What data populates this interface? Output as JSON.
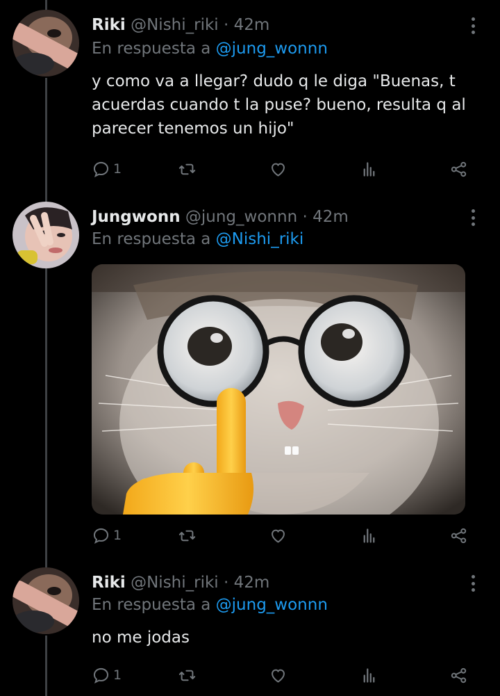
{
  "tweets": [
    {
      "name": "Riki",
      "handle": "@Nishi_riki",
      "dot": "·",
      "time": "42m",
      "reply_prefix": "En respuesta a",
      "reply_to": "@jung_wonnn",
      "text": "y como va a llegar? dudo q le diga \"Buenas, t acuerdas cuando t la puse? bueno, resulta q al parecer tenemos un hijo\"",
      "reply_count": "1"
    },
    {
      "name": "Jungwonn",
      "handle": "@jung_wonnn",
      "dot": "·",
      "time": "42m",
      "reply_prefix": "En respuesta a",
      "reply_to": "@Nishi_riki",
      "reply_count": "1",
      "media_description": "cat-with-glasses-meme"
    },
    {
      "name": "Riki",
      "handle": "@Nishi_riki",
      "dot": "·",
      "time": "42m",
      "reply_prefix": "En respuesta a",
      "reply_to": "@jung_wonnn",
      "text": "no me jodas",
      "reply_count": "1"
    }
  ],
  "icons": {
    "reply": "reply-icon",
    "retweet": "retweet-icon",
    "like": "heart-icon",
    "views": "views-icon",
    "share": "share-icon",
    "more": "more-options-icon"
  },
  "colors": {
    "background": "#000000",
    "text": "#e7e9ea",
    "muted": "#71767b",
    "accent": "#1d9bf0"
  }
}
